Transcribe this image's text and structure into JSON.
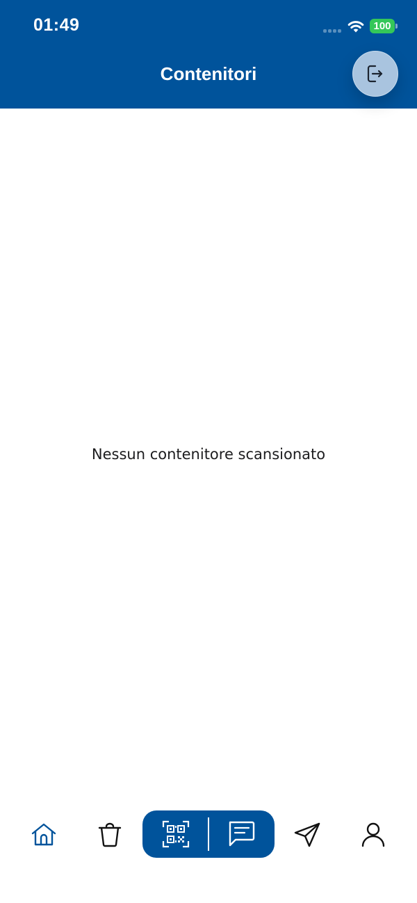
{
  "status_bar": {
    "time": "01:49",
    "battery": "100"
  },
  "header": {
    "title": "Contenitori",
    "logout_icon": "logout-icon"
  },
  "main": {
    "empty_message": "Nessun contenitore scansionato"
  },
  "tabbar": {
    "items": [
      {
        "icon": "home-icon",
        "active": true
      },
      {
        "icon": "trash-icon",
        "active": false
      },
      {
        "icon": "qr-code-icon",
        "active": false
      },
      {
        "icon": "chat-icon",
        "active": false
      },
      {
        "icon": "send-icon",
        "active": false
      },
      {
        "icon": "user-icon",
        "active": false
      }
    ]
  },
  "colors": {
    "brand": "#00539b",
    "battery": "#34c759",
    "logout_button": "#a9c4df"
  }
}
